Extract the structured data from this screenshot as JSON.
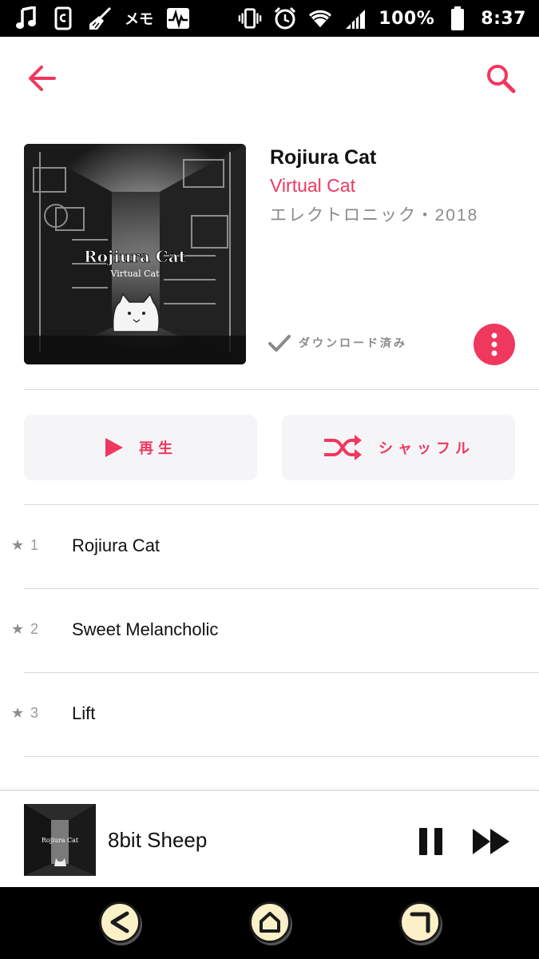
{
  "status_bar": {
    "battery": "100%",
    "time": "8:37",
    "memo": "メモ",
    "icons": [
      "music-note-icon",
      "phone-clipboard-icon",
      "broom-icon",
      "memo-text-icon",
      "pulse-icon",
      "vibrate-icon",
      "alarm-icon",
      "wifi-icon",
      "signal-icon",
      "battery-icon"
    ]
  },
  "app_bar": {
    "back_icon": "arrow-left-icon",
    "search_icon": "search-icon"
  },
  "album": {
    "title": "Rojiura Cat",
    "artist": "Virtual Cat",
    "meta": "エレクトロニック・2018",
    "art_title": "Rojiura Cat",
    "art_subtitle": "Virtual Cat",
    "downloaded_label": "ダウンロード済み",
    "more_icon": "more-vertical-icon"
  },
  "actions": {
    "play_label": "再生",
    "shuffle_label": "シャッフル"
  },
  "tracks": [
    {
      "num": "1",
      "title": "Rojiura Cat",
      "star": "★"
    },
    {
      "num": "2",
      "title": "Sweet Melancholic",
      "star": "★"
    },
    {
      "num": "3",
      "title": "Lift",
      "star": "★"
    }
  ],
  "mini_player": {
    "title": "8bit Sheep",
    "art_title": "Rojiura Cat"
  },
  "colors": {
    "accent": "#f0375e",
    "status_bar": "#000000",
    "nav_bar": "#000000",
    "button_bg": "#f5f5f8",
    "nav_button": "#fbf0c8"
  }
}
